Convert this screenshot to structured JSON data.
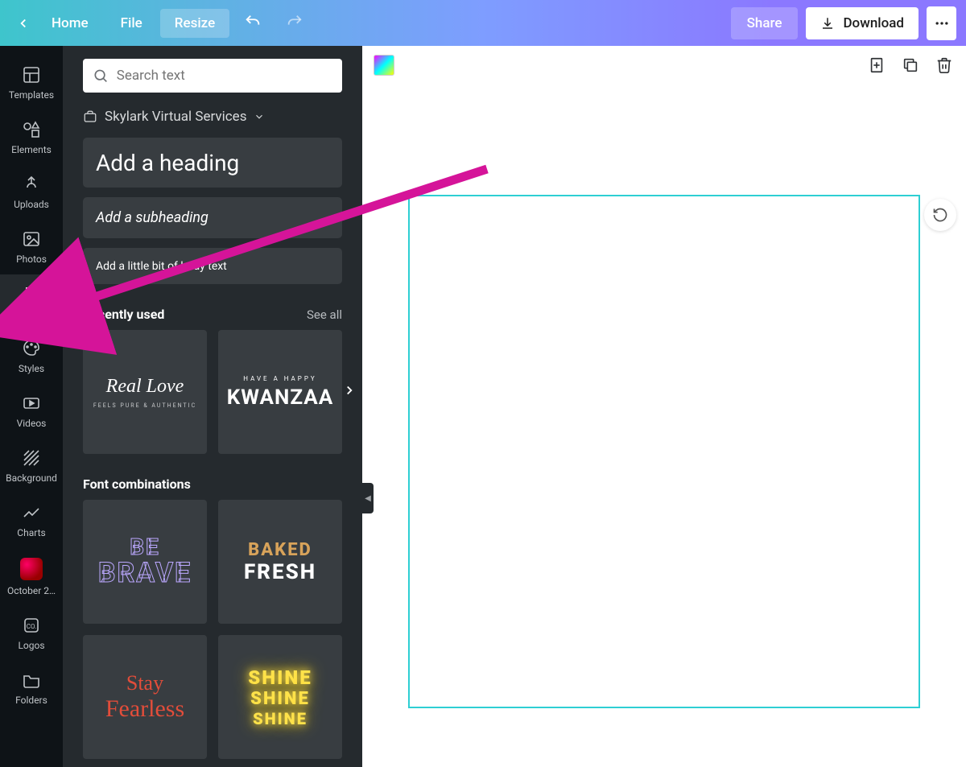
{
  "topbar": {
    "home": "Home",
    "file": "File",
    "resize": "Resize",
    "share": "Share",
    "download": "Download"
  },
  "rail": {
    "templates": "Templates",
    "elements": "Elements",
    "uploads": "Uploads",
    "photos": "Photos",
    "text": "Text",
    "styles": "Styles",
    "videos": "Videos",
    "background": "Background",
    "charts": "Charts",
    "october": "October 2…",
    "logos": "Logos",
    "folders": "Folders"
  },
  "panel": {
    "search_placeholder": "Search text",
    "brand": "Skylark Virtual Services",
    "heading": "Add a heading",
    "subheading": "Add a subheading",
    "body": "Add a little bit of body text",
    "recent_title": "Recently used",
    "see_all": "See all",
    "recent": {
      "real_love": "Real Love",
      "real_love_sub": "FEELS PURE & AUTHENTIC",
      "kwanzaa_top": "HAVE A HAPPY",
      "kwanzaa": "KWANZAA"
    },
    "font_combos_title": "Font combinations",
    "combo": {
      "be": "BE",
      "brave": "BRAVE",
      "baked": "BAKED",
      "fresh": "FRESH",
      "stay": "Stay",
      "fearless": "Fearless",
      "shine": "SHINE"
    }
  }
}
